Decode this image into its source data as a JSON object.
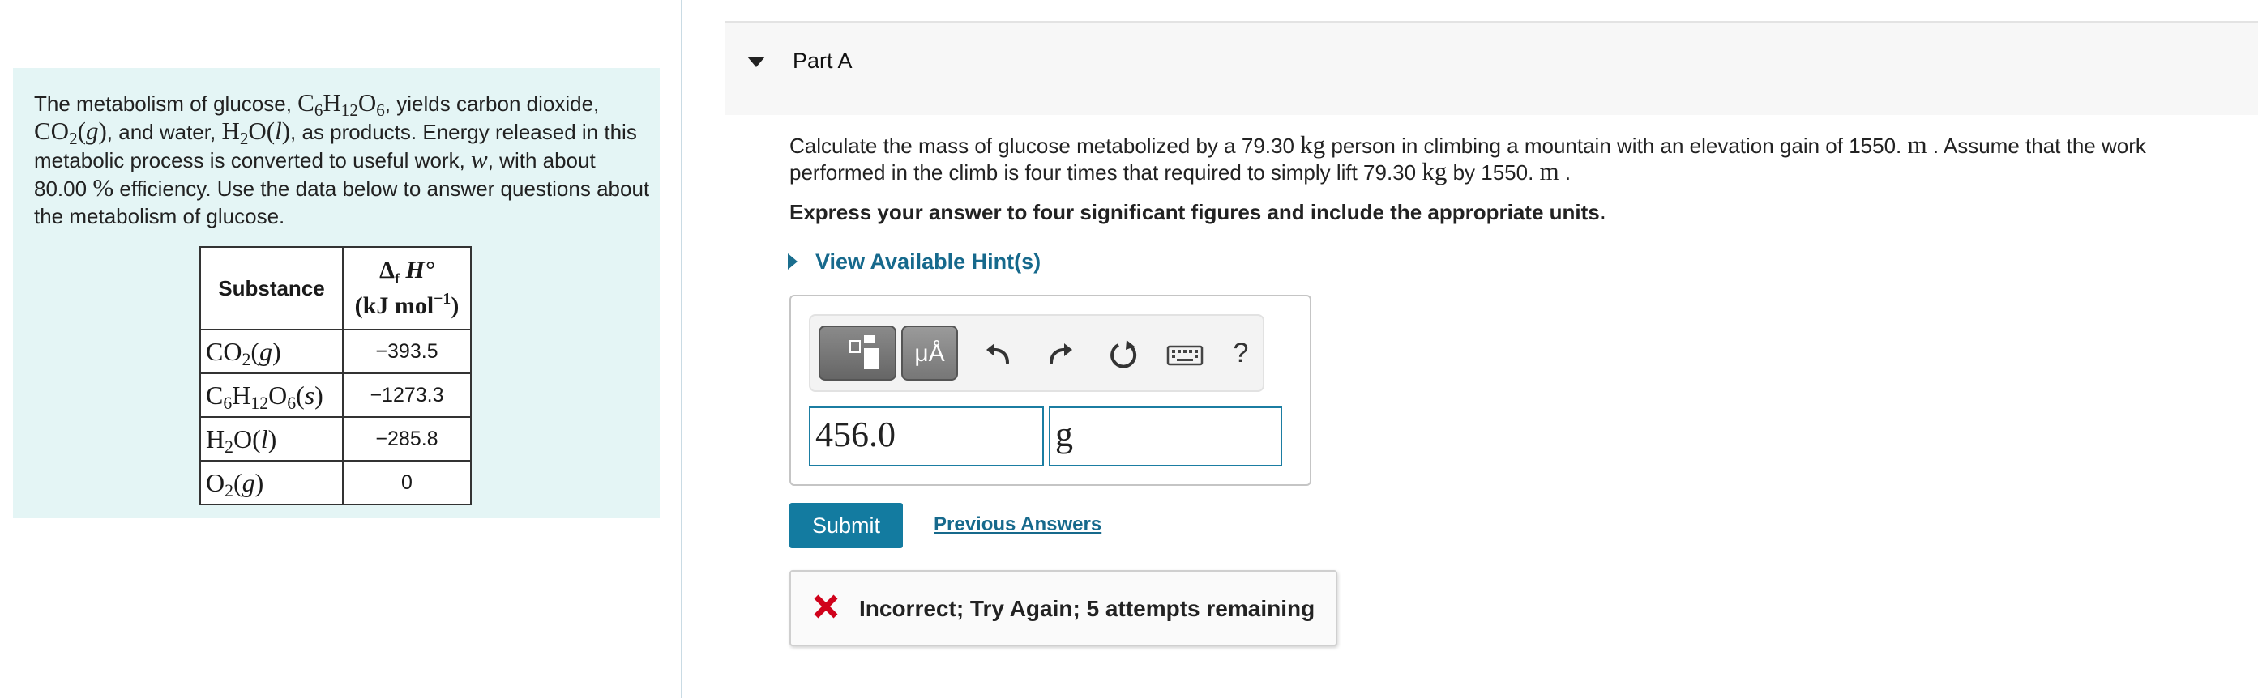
{
  "left_panel": {
    "intro": {
      "p1": "The metabolism of glucose, ",
      "glucose": {
        "a": "C",
        "s1": "6",
        "b": "H",
        "s2": "12",
        "c": "O",
        "s3": "6"
      },
      "p2": ", yields carbon dioxide,",
      "co2": {
        "a": "CO",
        "s1": "2",
        "b": "(",
        "state": "g",
        "c": ")"
      },
      "p3": ", and water, ",
      "h2o": {
        "a": "H",
        "s1": "2",
        "b": "O(",
        "state": "l",
        "c": ")"
      },
      "p4": ", as products. Energy released in this metabolic process is converted to useful work, ",
      "w": "w",
      "p5": ", with about",
      "eff_value": "80.00",
      "pct": "%",
      "p6": " efficiency.  Use the data below to answer questions about the metabolism of glucose."
    },
    "table": {
      "col1_header": "Substance",
      "col2_header_l1_a": "Δ",
      "col2_header_l1_sub": "f",
      "col2_header_l1_b": " H°",
      "col2_header_l2_a": "(kJ mol",
      "col2_header_l2_sup": "−1",
      "col2_header_l2_b": ")",
      "rows": [
        {
          "f": [
            "CO",
            "2",
            "(",
            "g",
            ")"
          ],
          "value": "−393.5"
        },
        {
          "f": [
            "C",
            "6",
            "H",
            "12",
            "O",
            "6",
            "(",
            "s",
            ")"
          ],
          "value": "−1273.3"
        },
        {
          "f": [
            "H",
            "2",
            "O(",
            "l",
            ")"
          ],
          "value": "−285.8"
        },
        {
          "f": [
            "O",
            "2",
            "(",
            "g",
            ")"
          ],
          "value": "0"
        }
      ]
    }
  },
  "part": {
    "title": "Part A",
    "question": {
      "t1": "Calculate the mass of glucose metabolized by a 79.30 ",
      "u1": "kg",
      "t2": " person in climbing a mountain with an elevation gain of 1550. ",
      "u2": "m",
      "t3": " . Assume that the work performed in the climb is four times that required to simply lift 79.30 ",
      "u3": "kg",
      "t4": " by 1550. ",
      "u4": "m",
      "t5": " ."
    },
    "instruction": "Express your answer to four significant figures and include the appropriate units.",
    "hints_label": "View Available Hint(s)",
    "toolbar": {
      "units_label": "μÅ",
      "help_label": "?"
    },
    "answer": {
      "value": "456.0",
      "unit": "g"
    },
    "submit_label": "Submit",
    "previous_answers_label": "Previous Answers",
    "feedback": "Incorrect; Try Again; 5 attempts remaining",
    "colors": {
      "accent": "#137ba0",
      "link": "#16698c",
      "error": "#d0021b",
      "panel_bg": "#e4f5f5"
    }
  }
}
